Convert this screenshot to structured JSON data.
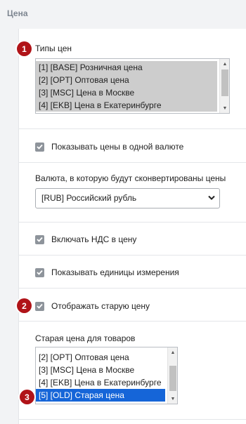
{
  "section": {
    "title": "Цена"
  },
  "price_types": {
    "badge": "1",
    "label": "Типы цен",
    "options": [
      "[1] [BASE] Розничная цена",
      "[2] [OPT] Оптовая цена",
      "[3] [MSC] Цена в Москве",
      "[4] [EKB] Цена в Екатеринбурге"
    ]
  },
  "one_currency": {
    "label": "Показывать цены в одной валюте",
    "checked": true
  },
  "currency": {
    "label": "Валюта, в которую будут сконвертированы цены",
    "value": "[RUB] Российский рубль"
  },
  "vat": {
    "label": "Включать НДС в цену",
    "checked": true
  },
  "units": {
    "label": "Показывать единицы измерения",
    "checked": true
  },
  "old_price": {
    "badge": "2",
    "label": "Отображать старую цену",
    "checked": true
  },
  "old_price_type": {
    "badge": "3",
    "label": "Старая цена для товаров",
    "options": [
      "[2] [OPT] Оптовая цена",
      "[3] [MSC] Цена в Москве",
      "[4] [EKB] Цена в Екатеринбурге",
      "[5] [OLD] Старая цена"
    ],
    "selected": "[5] [OLD] Старая цена"
  },
  "colors": {
    "badge": "#b01318",
    "selection": "#1565d8",
    "checkbox": "#8e949b"
  }
}
